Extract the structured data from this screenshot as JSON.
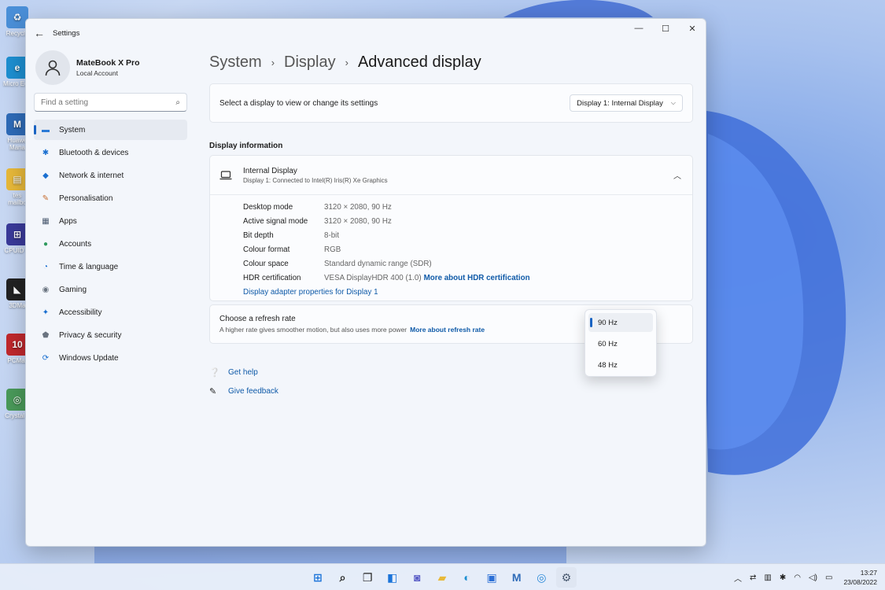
{
  "desktop": {
    "icons": [
      {
        "label": "Recycle",
        "icon": "recycle-bin-icon",
        "color": "#4a8fd8"
      },
      {
        "label": "Micro Edg",
        "icon": "edge-icon",
        "color": "#1d8fd1"
      },
      {
        "label": "Huawe Mana",
        "icon": "huawei-manager-icon",
        "color": "#2e6bb8"
      },
      {
        "label": "tes mailbo",
        "icon": "folder-icon",
        "color": "#e8b93a"
      },
      {
        "label": "CPUID C",
        "icon": "cpuid-icon",
        "color": "#3a3a9a"
      },
      {
        "label": "3DMa",
        "icon": "3dmark-icon",
        "color": "#222222"
      },
      {
        "label": "PCMar",
        "icon": "pcmark-icon",
        "color": "#c0282d"
      },
      {
        "label": "Crystal 8",
        "icon": "crystaldisk-icon",
        "color": "#4a9a5a"
      }
    ]
  },
  "window": {
    "title": "Settings",
    "controls": {
      "minimize": "—",
      "maximize": "☐",
      "close": "✕"
    }
  },
  "profile": {
    "name": "MateBook X Pro",
    "account": "Local Account"
  },
  "search": {
    "placeholder": "Find a setting"
  },
  "sidebar": {
    "items": [
      {
        "label": "System",
        "icon": "monitor-icon",
        "active": true
      },
      {
        "label": "Bluetooth & devices",
        "icon": "bluetooth-icon"
      },
      {
        "label": "Network & internet",
        "icon": "wifi-icon"
      },
      {
        "label": "Personalisation",
        "icon": "brush-icon"
      },
      {
        "label": "Apps",
        "icon": "apps-icon"
      },
      {
        "label": "Accounts",
        "icon": "person-icon"
      },
      {
        "label": "Time & language",
        "icon": "globe-clock-icon"
      },
      {
        "label": "Gaming",
        "icon": "gamepad-icon"
      },
      {
        "label": "Accessibility",
        "icon": "accessibility-icon"
      },
      {
        "label": "Privacy & security",
        "icon": "shield-icon"
      },
      {
        "label": "Windows Update",
        "icon": "update-icon"
      }
    ]
  },
  "breadcrumb": {
    "items": [
      "System",
      "Display"
    ],
    "current": "Advanced display",
    "separator": "›"
  },
  "display_select": {
    "label": "Select a display to view or change its settings",
    "value": "Display 1: Internal Display"
  },
  "display_info": {
    "section_title": "Display information",
    "name": "Internal Display",
    "connection": "Display 1: Connected to Intel(R) Iris(R) Xe Graphics",
    "rows": [
      {
        "label": "Desktop mode",
        "value": "3120 × 2080, 90 Hz"
      },
      {
        "label": "Active signal mode",
        "value": "3120 × 2080, 90 Hz"
      },
      {
        "label": "Bit depth",
        "value": "8-bit"
      },
      {
        "label": "Colour format",
        "value": "RGB"
      },
      {
        "label": "Colour space",
        "value": "Standard dynamic range (SDR)"
      },
      {
        "label": "HDR certification",
        "value": "VESA DisplayHDR 400 (1.0)",
        "link": "More about HDR certification"
      }
    ],
    "adapter_link": "Display adapter properties for Display 1"
  },
  "refresh": {
    "title": "Choose a refresh rate",
    "subtitle": "A higher rate gives smoother motion, but also uses more power",
    "link": "More about refresh rate",
    "options": [
      "90 Hz",
      "60 Hz",
      "48 Hz"
    ],
    "selected": "90 Hz"
  },
  "help": {
    "get_help": "Get help",
    "give_feedback": "Give feedback"
  },
  "taskbar": {
    "apps": [
      {
        "name": "start-button",
        "icon": "windows-icon",
        "color": "#1a73d9"
      },
      {
        "name": "search-button",
        "icon": "search-icon",
        "color": "#222222"
      },
      {
        "name": "task-view-button",
        "icon": "task-view-icon",
        "color": "#222222"
      },
      {
        "name": "widgets-button",
        "icon": "widgets-icon",
        "color": "#1a73d9"
      },
      {
        "name": "chat-button",
        "icon": "teams-chat-icon",
        "color": "#5b5fc7"
      },
      {
        "name": "file-explorer-button",
        "icon": "folder-icon",
        "color": "#e8b93a"
      },
      {
        "name": "edge-button",
        "icon": "edge-icon",
        "color": "#1d8fd1"
      },
      {
        "name": "store-button",
        "icon": "store-icon",
        "color": "#2b6fd6"
      },
      {
        "name": "huawei-button",
        "icon": "huawei-manager-icon",
        "color": "#2e6bb8"
      },
      {
        "name": "app-button",
        "icon": "app-icon",
        "color": "#2b8ad9"
      },
      {
        "name": "settings-button",
        "icon": "gear-icon",
        "color": "#4a5a70",
        "active": true
      }
    ],
    "time": "13:27",
    "date": "23/08/2022"
  }
}
